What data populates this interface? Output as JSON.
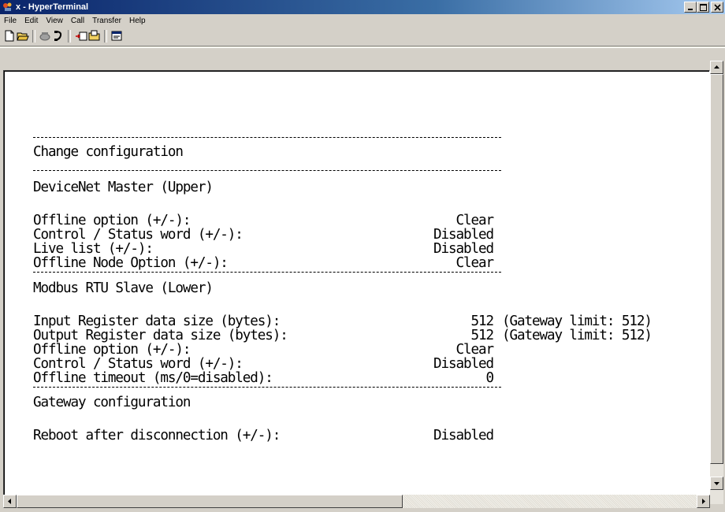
{
  "window": {
    "title": "x - HyperTerminal",
    "controls": [
      "minimize-icon",
      "maximize-icon",
      "close-icon"
    ]
  },
  "menu": {
    "items": [
      {
        "label": "File"
      },
      {
        "label": "Edit"
      },
      {
        "label": "View"
      },
      {
        "label": "Call"
      },
      {
        "label": "Transfer"
      },
      {
        "label": "Help"
      }
    ]
  },
  "toolbar": {
    "buttons": [
      "new-connection-icon",
      "open-icon",
      "disconnect-phone-icon",
      "connect-phone-icon",
      "send-file-icon",
      "receive-file-icon",
      "properties-icon"
    ]
  },
  "terminal": {
    "heading": "Change configuration",
    "sections": [
      {
        "title": "DeviceNet Master (Upper)",
        "rows": [
          {
            "label": "Offline option (+/-):",
            "value": "Clear",
            "extra": ""
          },
          {
            "label": "Control / Status word (+/-):",
            "value": "Disabled",
            "extra": ""
          },
          {
            "label": "Live list (+/-):",
            "value": "Disabled",
            "extra": ""
          },
          {
            "label": "Offline Node Option (+/-):",
            "value": "Clear",
            "extra": ""
          }
        ]
      },
      {
        "title": "Modbus RTU Slave (Lower)",
        "rows": [
          {
            "label": "Input Register data size (bytes):",
            "value": "512",
            "extra": "(Gateway limit: 512)"
          },
          {
            "label": "Output Register data size (bytes):",
            "value": "512",
            "extra": "(Gateway limit: 512)"
          },
          {
            "label": "Offline option (+/-):",
            "value": "Clear",
            "extra": ""
          },
          {
            "label": "Control / Status word (+/-):",
            "value": "Disabled",
            "extra": ""
          },
          {
            "label": "Offline timeout (ms/0=disabled):",
            "value": "0",
            "extra": ""
          }
        ]
      },
      {
        "title": "Gateway configuration",
        "rows": [
          {
            "label": "Reboot after disconnection (+/-):",
            "value": "Disabled",
            "extra": ""
          }
        ]
      }
    ]
  },
  "colors": {
    "titlebar_start": "#0a246a",
    "titlebar_end": "#a6caf0",
    "chrome": "#d4d0c8",
    "terminal_bg": "#ffffff",
    "terminal_fg": "#000000"
  }
}
